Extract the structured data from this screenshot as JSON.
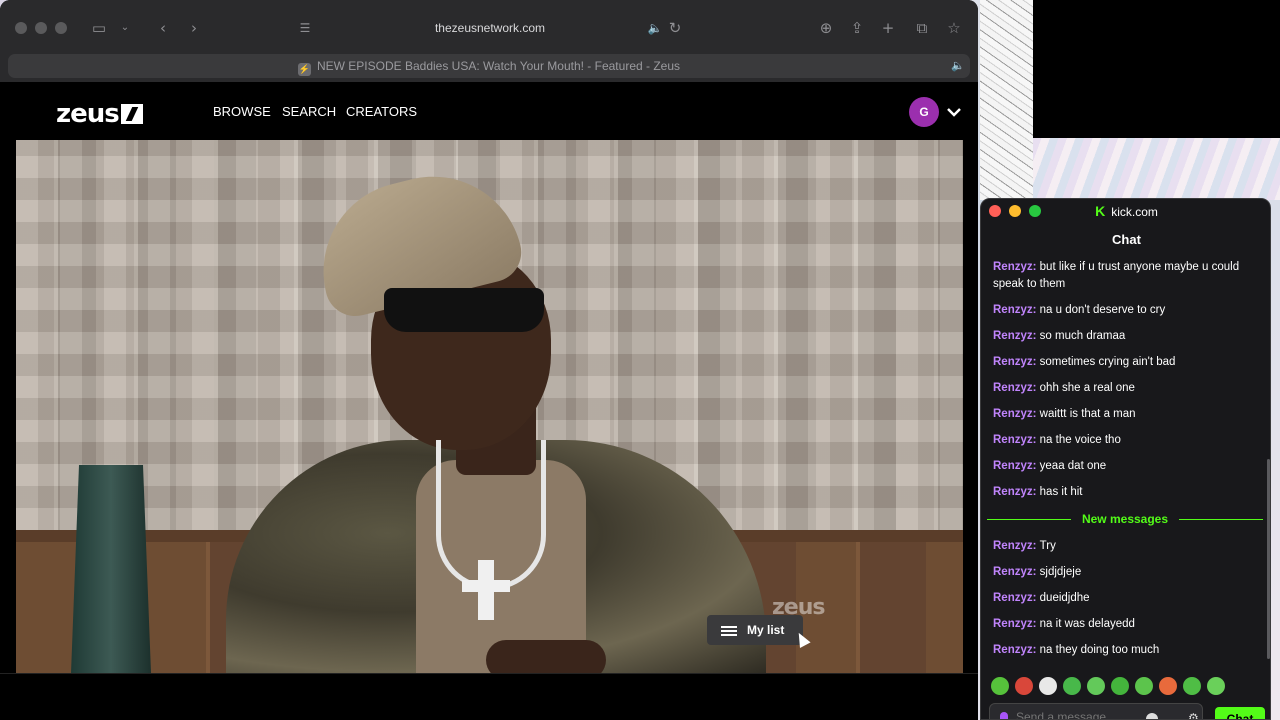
{
  "browser": {
    "url": "thezeusnetwork.com",
    "tab_title": "NEW EPISODE Baddies USA: Watch Your Mouth! - Featured - Zeus",
    "icons": [
      "sidebar-icon",
      "back-icon",
      "forward-icon",
      "reader-icon",
      "speaker-icon",
      "reload-icon",
      "download-icon",
      "share-icon",
      "new-tab-icon",
      "tabs-overview-icon",
      "bookmark-icon"
    ]
  },
  "site": {
    "logo": "zeus",
    "nav": [
      "BROWSE",
      "SEARCH",
      "CREATORS"
    ],
    "avatar_initial": "G",
    "watermark": "zeus",
    "mylist_label": "My list"
  },
  "chat": {
    "domain": "kick.com",
    "kick_logo": "K",
    "header": "Chat",
    "messages_before": [
      {
        "user": "Renzyz",
        "text": "but like if u trust anyone maybe u could speak to them"
      },
      {
        "user": "Renzyz",
        "text": "na u don't deserve to cry"
      },
      {
        "user": "Renzyz",
        "text": "so much dramaa"
      },
      {
        "user": "Renzyz",
        "text": "sometimes crying ain't bad"
      },
      {
        "user": "Renzyz",
        "text": "ohh she a real one"
      },
      {
        "user": "Renzyz",
        "text": "waittt is that a man"
      },
      {
        "user": "Renzyz",
        "text": "na the voice tho"
      },
      {
        "user": "Renzyz",
        "text": "yeaa dat one"
      },
      {
        "user": "Renzyz",
        "text": "has it hit"
      }
    ],
    "new_messages_label": "New messages",
    "messages_after": [
      {
        "user": "Renzyz",
        "text": "Try"
      },
      {
        "user": "Renzyz",
        "text": "sjdjdjeje"
      },
      {
        "user": "Renzyz",
        "text": "dueidjdhe"
      },
      {
        "user": "Renzyz",
        "text": "na it was delayedd"
      },
      {
        "user": "Renzyz",
        "text": "na they doing too much"
      }
    ],
    "input_placeholder": "Send a message",
    "send_label": "Chat",
    "colors": {
      "accent": "#53fc18",
      "username": "#c084fc"
    }
  }
}
